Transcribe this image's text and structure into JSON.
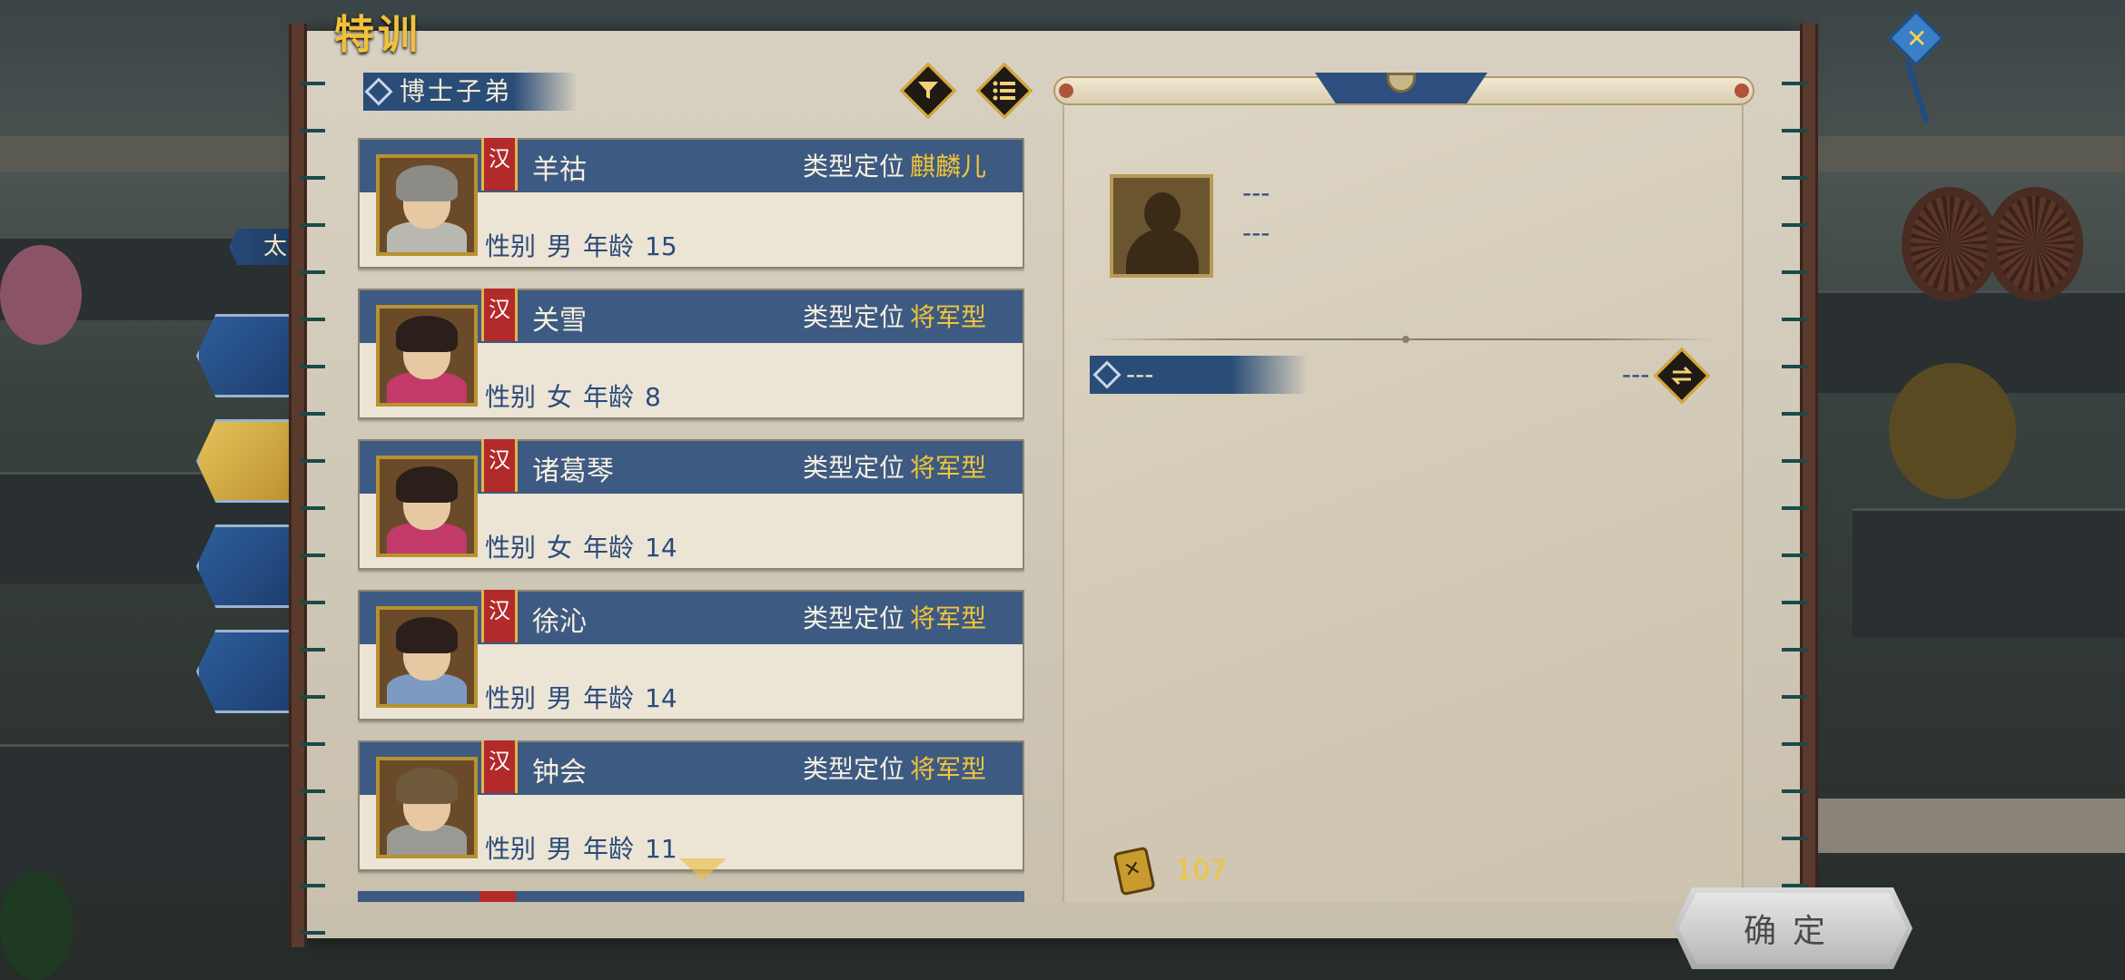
{
  "screen": {
    "title": "特训"
  },
  "left_tabs": {
    "partial_label": "太"
  },
  "list_header": {
    "category": "博士子弟",
    "filter_icon": "funnel-icon",
    "sort_icon": "list-icon"
  },
  "students": [
    {
      "faction": "汉",
      "name": "羊祜",
      "type_label": "类型定位",
      "type_value": "麒麟儿",
      "gender_label": "性别",
      "gender": "男",
      "age_label": "年龄",
      "age": "15"
    },
    {
      "faction": "汉",
      "name": "关雪",
      "type_label": "类型定位",
      "type_value": "将军型",
      "gender_label": "性别",
      "gender": "女",
      "age_label": "年龄",
      "age": "8"
    },
    {
      "faction": "汉",
      "name": "诸葛琴",
      "type_label": "类型定位",
      "type_value": "将军型",
      "gender_label": "性别",
      "gender": "女",
      "age_label": "年龄",
      "age": "14"
    },
    {
      "faction": "汉",
      "name": "徐沁",
      "type_label": "类型定位",
      "type_value": "将军型",
      "gender_label": "性别",
      "gender": "男",
      "age_label": "年龄",
      "age": "14"
    },
    {
      "faction": "汉",
      "name": "钟会",
      "type_label": "类型定位",
      "type_value": "将军型",
      "gender_label": "性别",
      "gender": "男",
      "age_label": "年龄",
      "age": "11"
    }
  ],
  "detail": {
    "line1": "---",
    "line2": "---",
    "sub_label": "---",
    "sub_value": "---",
    "swap_icon": "swap-arrows-icon"
  },
  "currency": {
    "icon": "token-icon",
    "value": "107"
  },
  "confirm_label": "确定",
  "colors": {
    "card_band": "#3d5a82",
    "gold_text": "#f0c43a",
    "faction_red": "#b22a2a",
    "panel_parchment": "#d8d1c2"
  }
}
